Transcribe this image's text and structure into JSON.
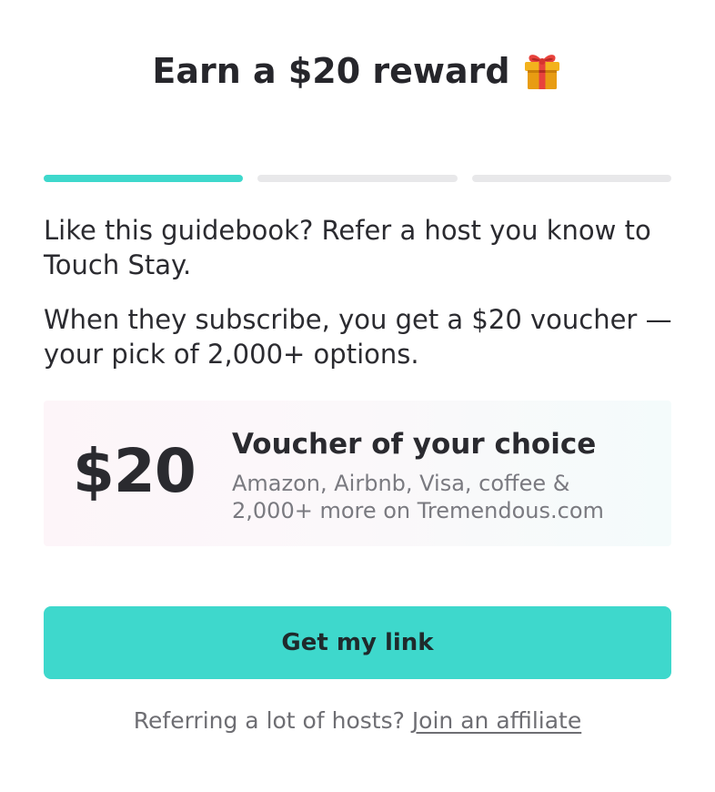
{
  "header": {
    "title": "Earn a $20 reward",
    "icon": "gift-icon"
  },
  "progress": {
    "steps": 3,
    "current_step": 1,
    "active_color": "#3ed8cc",
    "inactive_color": "#e8e8ea"
  },
  "body": {
    "paragraph_1": "Like this guidebook? Refer a host you know to Touch Stay.",
    "paragraph_2": "When they subscribe, you get a $20 voucher — your pick of 2,000+ options."
  },
  "voucher": {
    "amount": "$20",
    "title": "Voucher of your choice",
    "description": "Amazon, Airbnb, Visa, coffee & 2,000+ more on Tremendous.com"
  },
  "cta": {
    "label": "Get my link",
    "color": "#3ed8cc"
  },
  "footer": {
    "prefix": "Referring a lot of hosts?",
    "link_label": "Join an affiliate"
  }
}
